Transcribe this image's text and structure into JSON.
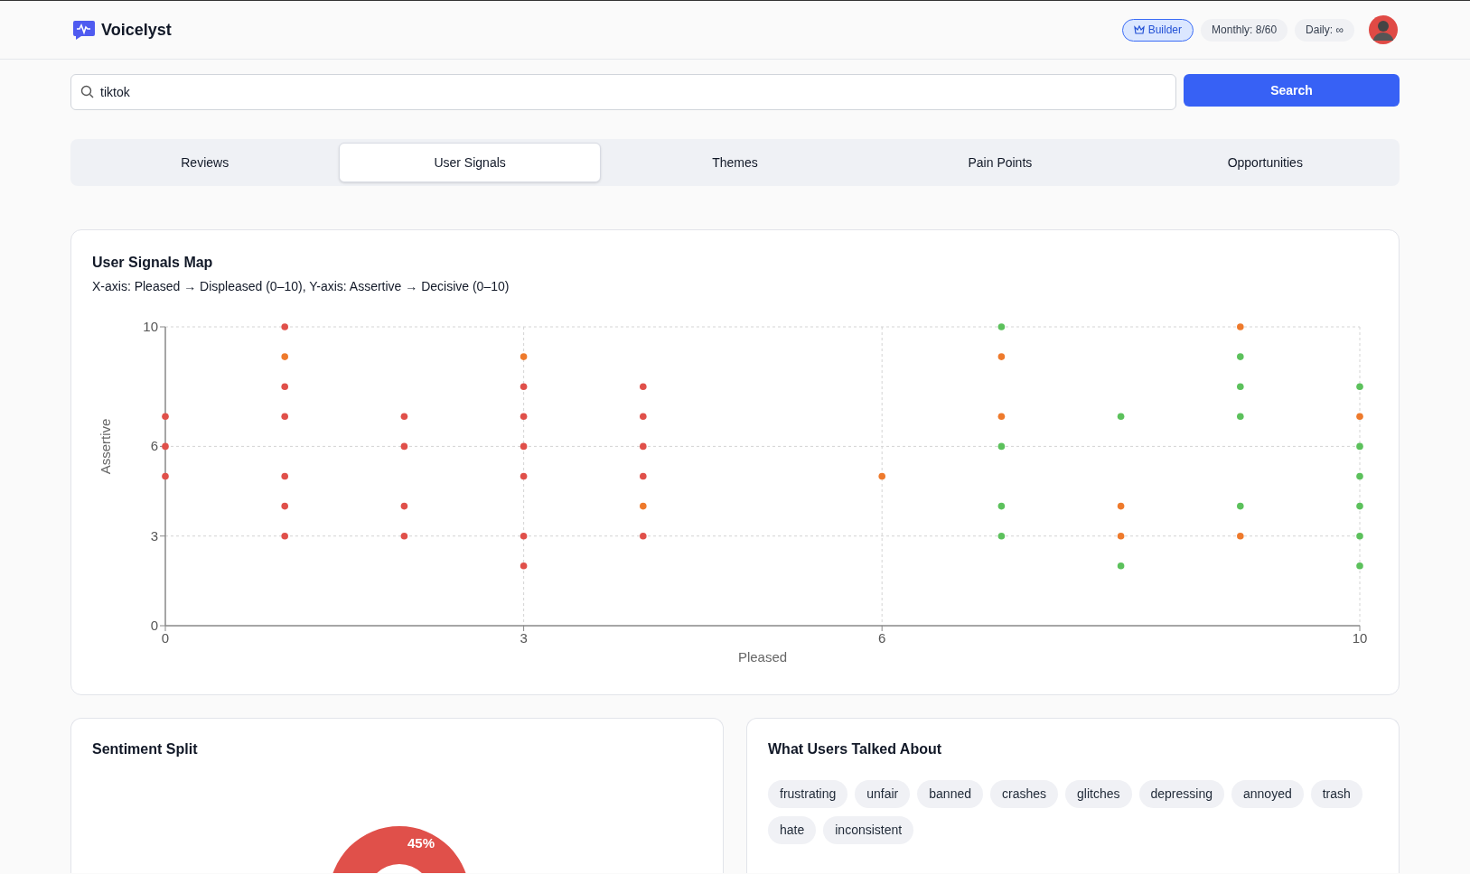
{
  "app": {
    "name": "Voicelyst"
  },
  "header": {
    "plan": "Builder",
    "monthly": "Monthly: 8/60",
    "daily": "Daily: ∞"
  },
  "search": {
    "value": "tiktok",
    "button": "Search"
  },
  "tabs": [
    {
      "label": "Reviews",
      "selected": false
    },
    {
      "label": "User Signals",
      "selected": true
    },
    {
      "label": "Themes",
      "selected": false
    },
    {
      "label": "Pain Points",
      "selected": false
    },
    {
      "label": "Opportunities",
      "selected": false
    }
  ],
  "signals_map": {
    "title": "User Signals Map",
    "subtitle": "X-axis: Pleased → Displeased (0–10), Y-axis: Assertive → Decisive (0–10)",
    "chart_data": {
      "type": "scatter",
      "grid": true,
      "xlabel": "Pleased",
      "ylabel": "Assertive",
      "xlim": [
        0,
        10
      ],
      "ylim": [
        0,
        10
      ],
      "xticks": [
        0,
        3,
        6,
        10
      ],
      "yticks": [
        0,
        3,
        6,
        10
      ],
      "series": [
        {
          "color": "#e0504a",
          "x": [
            0,
            0,
            0,
            1,
            1,
            1,
            1,
            1,
            1,
            2,
            2,
            2,
            2,
            3,
            3,
            3,
            3,
            3,
            3,
            4,
            4,
            4,
            4,
            4
          ],
          "values": [
            7,
            6,
            5,
            10,
            8,
            7,
            5,
            4,
            3,
            7,
            6,
            4,
            3,
            8,
            7,
            6,
            5,
            3,
            2,
            8,
            7,
            6,
            5,
            3
          ]
        },
        {
          "color": "#ee7a2c",
          "x": [
            1,
            3,
            4,
            6,
            7,
            7,
            8,
            8,
            9,
            9,
            10
          ],
          "values": [
            9,
            9,
            4,
            5,
            9,
            7,
            4,
            3,
            10,
            3,
            7
          ]
        },
        {
          "color": "#5cc15c",
          "x": [
            7,
            7,
            7,
            7,
            8,
            8,
            9,
            9,
            9,
            9,
            10,
            10,
            10,
            10,
            10,
            10
          ],
          "values": [
            10,
            6,
            4,
            3,
            7,
            2,
            9,
            8,
            7,
            4,
            8,
            6,
            5,
            4,
            3,
            2
          ]
        }
      ]
    }
  },
  "sentiment": {
    "title": "Sentiment Split",
    "slice_label": "45%"
  },
  "topics": {
    "title": "What Users Talked About",
    "tags": [
      "frustrating",
      "unfair",
      "banned",
      "crashes",
      "glitches",
      "depressing",
      "annoyed",
      "trash",
      "hate",
      "inconsistent"
    ]
  }
}
